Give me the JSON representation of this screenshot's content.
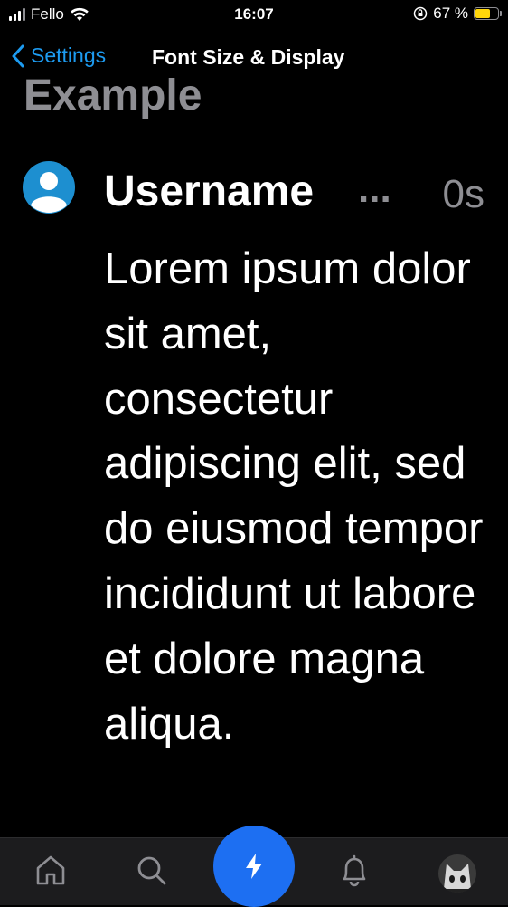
{
  "status_bar": {
    "carrier": "Fello",
    "time": "16:07",
    "battery_percent": "67 %",
    "battery_level": 0.67,
    "icons": [
      "signal-icon",
      "wifi-icon",
      "rotation-lock-icon",
      "battery-icon"
    ]
  },
  "nav": {
    "back_label": "Settings",
    "title": "Font Size & Display"
  },
  "section": {
    "title": "Example"
  },
  "post": {
    "username": "Username",
    "ellipsis": "...",
    "timestamp": "0s",
    "body": "Lorem ipsum dolor sit amet, consectetur adipiscing elit, sed do eiusmod tempor incididunt ut labore et dolore magna aliqua."
  },
  "tab_bar": {
    "tabs": [
      "home-icon",
      "search-icon",
      "compose-icon",
      "notifications-icon",
      "profile-avatar"
    ]
  },
  "colors": {
    "accent": "#1d9bf0",
    "compose": "#1d6ff2",
    "muted": "#8e8e93",
    "battery": "#ffd60a"
  }
}
